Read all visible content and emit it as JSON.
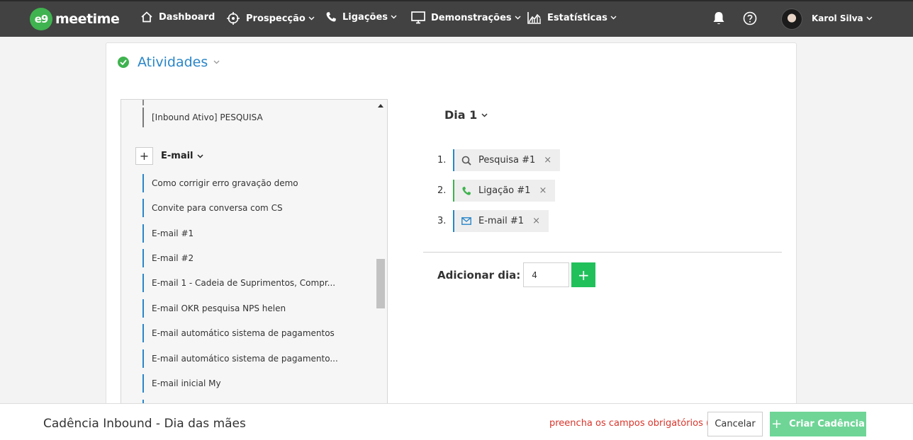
{
  "nav": {
    "logo_badge": "e9",
    "logo_text": "meetime",
    "items": [
      {
        "label": "Dashboard",
        "icon": "home-icon",
        "has_dropdown": false
      },
      {
        "label": "Prospecção",
        "icon": "target-icon",
        "has_dropdown": true
      },
      {
        "label": "Ligações",
        "icon": "phone-icon",
        "has_dropdown": true
      },
      {
        "label": "Demonstrações",
        "icon": "monitor-icon",
        "has_dropdown": true
      },
      {
        "label": "Estatísticas",
        "icon": "chart-icon",
        "has_dropdown": true
      }
    ],
    "user_name": "Karol Silva"
  },
  "section": {
    "title": "Atividades",
    "status_icon": "check-circle-icon"
  },
  "list": {
    "top_item": "[Inbound Ativo] PESQUISA",
    "group_label": "E-mail",
    "email_items": [
      "Como corrigir erro gravação demo",
      "Convite para conversa com CS",
      "E-mail #1",
      "E-mail #2",
      "E-mail 1 - Cadeia de Suprimentos, Compr...",
      "E-mail OKR pesquisa NPS helen",
      "E-mail automático sistema de pagamentos",
      "E-mail automático sistema de pagamento...",
      "E-mail inicial My"
    ]
  },
  "day": {
    "title": "Dia 1",
    "activities": [
      {
        "num": "1.",
        "label": "Pesquisa #1",
        "icon": "search-icon",
        "color": "#2a86c8"
      },
      {
        "num": "2.",
        "label": "Ligação #1",
        "icon": "phone-icon",
        "color": "#3fb34f"
      },
      {
        "num": "3.",
        "label": "E-mail #1",
        "icon": "mail-icon",
        "color": "#2a86c8"
      }
    ],
    "remove_symbol": "×",
    "add_day_label": "Adicionar dia:",
    "add_day_value": "4",
    "add_day_button": "+"
  },
  "footer": {
    "title": "Cadência Inbound - Dia das mães",
    "warning": "preencha os campos obrigatórios (*)",
    "cancel": "Cancelar",
    "create_plus": "+",
    "create": "Criar Cadência"
  },
  "colors": {
    "topbar": "#424242",
    "accent_blue": "#2a86c8",
    "green": "#3fb34f",
    "add_green": "#21c05b",
    "create_green": "#6fd597",
    "warning_red": "#d9352b"
  }
}
